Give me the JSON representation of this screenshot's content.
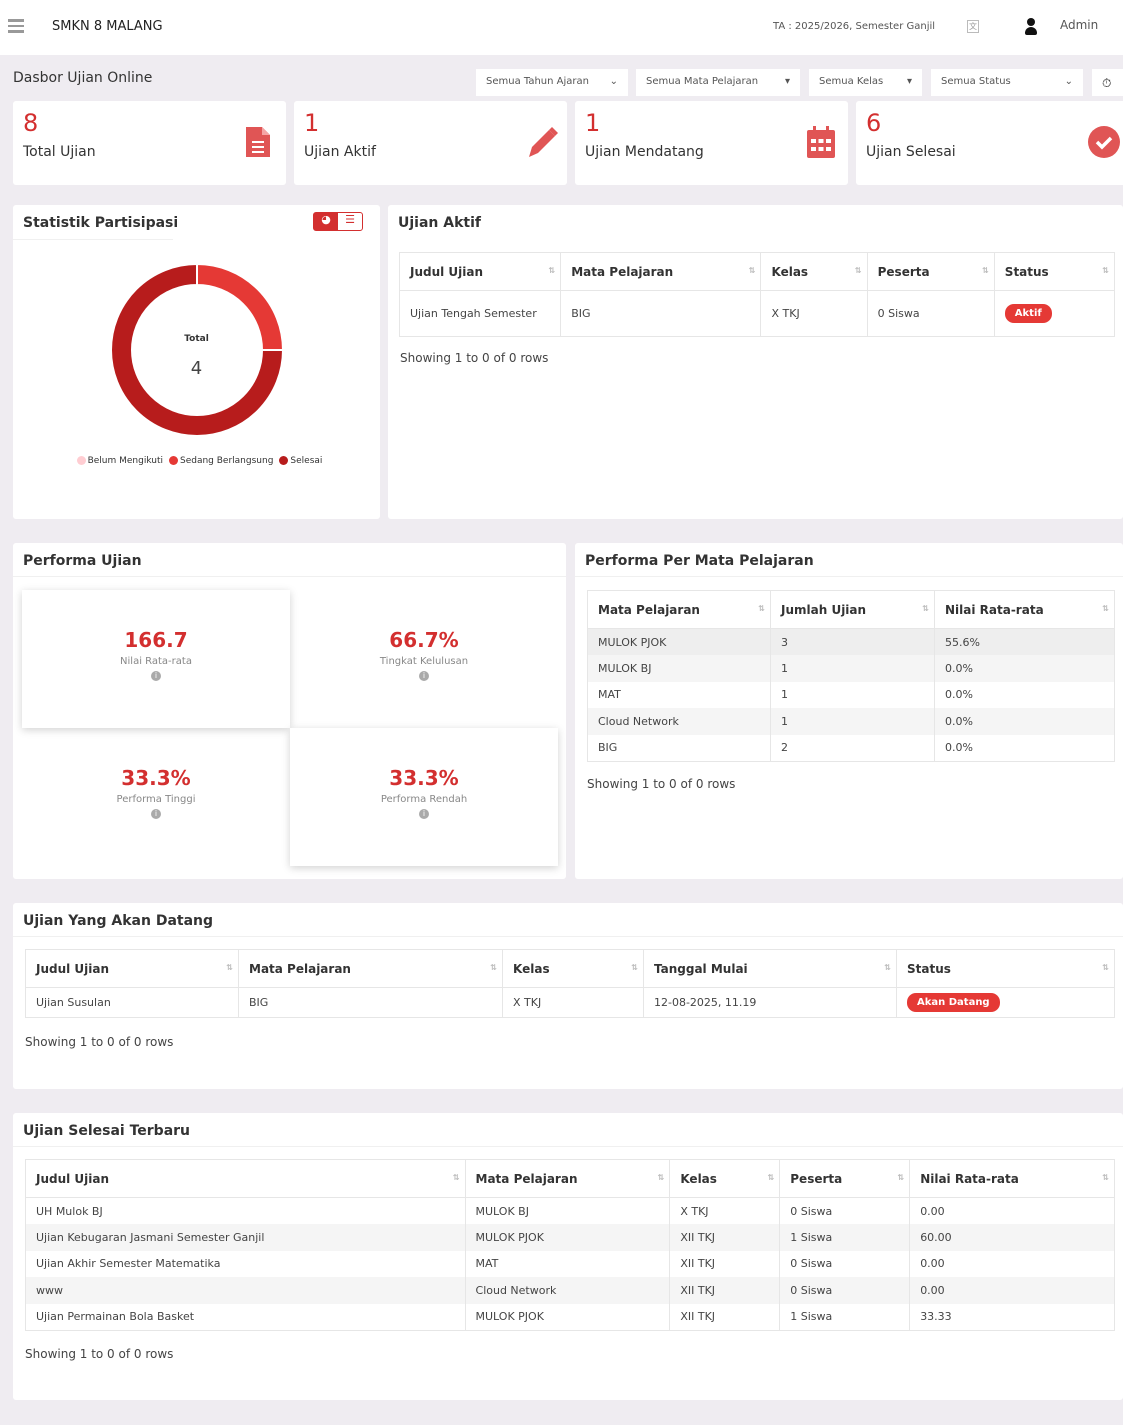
{
  "header": {
    "school": "SMKN 8 MALANG",
    "period": "TA : 2025/2026, Semester Ganjil",
    "user": "Admin"
  },
  "page_title": "Dasbor Ujian Online",
  "filters": [
    "Semua Tahun Ajaran",
    "Semua Mata Pelajaran",
    "Semua Kelas",
    "Semua Status"
  ],
  "stats": [
    {
      "value": "8",
      "label": "Total Ujian",
      "icon": "file-icon"
    },
    {
      "value": "1",
      "label": "Ujian Aktif",
      "icon": "pencil-icon"
    },
    {
      "value": "1",
      "label": "Ujian Mendatang",
      "icon": "calendar-icon"
    },
    {
      "value": "6",
      "label": "Ujian Selesai",
      "icon": "check-circle-icon"
    }
  ],
  "participation": {
    "title": "Statistik Partisipasi",
    "center_label": "Total",
    "center_value": "4",
    "chart_data": {
      "type": "pie",
      "categories": [
        "Belum Mengikuti",
        "Sedang Berlangsung",
        "Selesai"
      ],
      "values": [
        0,
        1,
        3
      ],
      "colors": [
        "#ffcdd2",
        "#e53935",
        "#b71c1c"
      ],
      "legend": "bottom"
    }
  },
  "active": {
    "title": "Ujian Aktif",
    "columns": [
      "Judul Ujian",
      "Mata Pelajaran",
      "Kelas",
      "Peserta",
      "Status"
    ],
    "rows": [
      [
        "Ujian Tengah Semester",
        "BIG",
        "X TKJ",
        "0 Siswa",
        "Aktif"
      ]
    ],
    "showing": "Showing 1 to 0 of 0 rows"
  },
  "performance": {
    "title": "Performa Ujian",
    "items": [
      {
        "value": "166.7",
        "label": "Nilai Rata-rata"
      },
      {
        "value": "66.7%",
        "label": "Tingkat Kelulusan"
      },
      {
        "value": "33.3%",
        "label": "Performa Tinggi"
      },
      {
        "value": "33.3%",
        "label": "Performa Rendah"
      }
    ]
  },
  "subject_perf": {
    "title": "Performa Per Mata Pelajaran",
    "columns": [
      "Mata Pelajaran",
      "Jumlah Ujian",
      "Nilai Rata-rata"
    ],
    "rows": [
      [
        "MULOK PJOK",
        "3",
        "55.6%"
      ],
      [
        "MULOK BJ",
        "1",
        "0.0%"
      ],
      [
        "MAT",
        "1",
        "0.0%"
      ],
      [
        "Cloud Network",
        "1",
        "0.0%"
      ],
      [
        "BIG",
        "2",
        "0.0%"
      ]
    ],
    "showing": "Showing 1 to 0 of 0 rows"
  },
  "upcoming": {
    "title": "Ujian Yang Akan Datang",
    "columns": [
      "Judul Ujian",
      "Mata Pelajaran",
      "Kelas",
      "Tanggal Mulai",
      "Status"
    ],
    "rows": [
      [
        "Ujian Susulan",
        "BIG",
        "X TKJ",
        "12-08-2025, 11.19",
        "Akan Datang"
      ]
    ],
    "showing": "Showing 1 to 0 of 0 rows"
  },
  "finished": {
    "title": "Ujian Selesai Terbaru",
    "columns": [
      "Judul Ujian",
      "Mata Pelajaran",
      "Kelas",
      "Peserta",
      "Nilai Rata-rata"
    ],
    "rows": [
      [
        "UH Mulok BJ",
        "MULOK BJ",
        "X TKJ",
        "0 Siswa",
        "0.00"
      ],
      [
        "Ujian Kebugaran Jasmani Semester Ganjil",
        "MULOK PJOK",
        "XII TKJ",
        "1 Siswa",
        "60.00"
      ],
      [
        "Ujian Akhir Semester Matematika",
        "MAT",
        "XII TKJ",
        "0 Siswa",
        "0.00"
      ],
      [
        "www",
        "Cloud Network",
        "XII TKJ",
        "0 Siswa",
        "0.00"
      ],
      [
        "Ujian Permainan Bola Basket",
        "MULOK PJOK",
        "XII TKJ",
        "1 Siswa",
        "33.33"
      ]
    ],
    "showing": "Showing 1 to 0 of 0 rows"
  }
}
